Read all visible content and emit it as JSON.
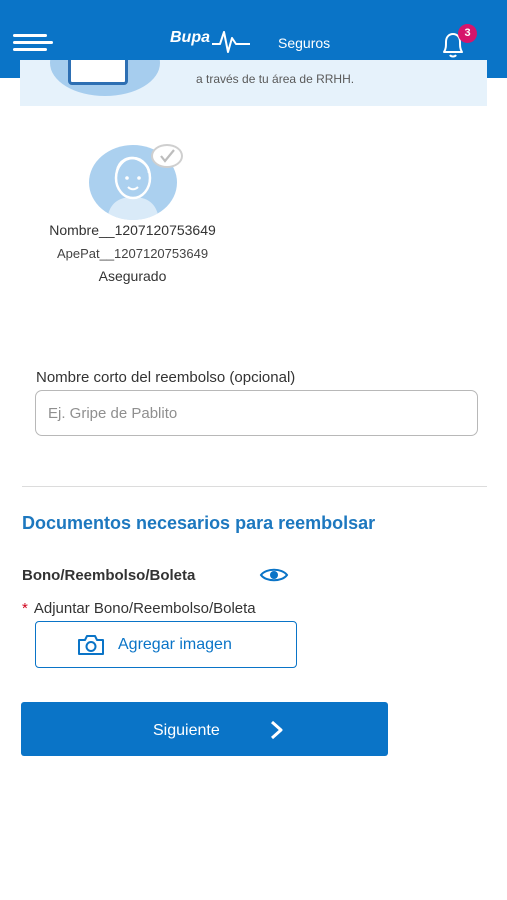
{
  "header": {
    "brand": "Bupa",
    "section": "Seguros",
    "notification_count": "3",
    "icons": {
      "menu": "hamburger-menu-icon",
      "notifications": "bell-icon"
    },
    "colors": {
      "bar": "#0a74c7",
      "badge": "#d6156b"
    }
  },
  "banner": {
    "text": "a través de tu área de RRHH."
  },
  "insured": {
    "name": "Nombre__1207120753649",
    "surname": "ApePat__1207120753649",
    "role": "Asegurado",
    "selected": true
  },
  "short_name": {
    "label": "Nombre corto del reembolso (opcional)",
    "placeholder": "Ej. Gripe de Pablito",
    "value": ""
  },
  "documents": {
    "title": "Documentos necesarios para reembolsar",
    "doc_type": "Bono/Reembolso/Boleta",
    "required_mark": "*",
    "attach_label": "Adjuntar Bono/Reembolso/Boleta",
    "add_image_label": "Agregar imagen"
  },
  "actions": {
    "next_label": "Siguiente"
  }
}
